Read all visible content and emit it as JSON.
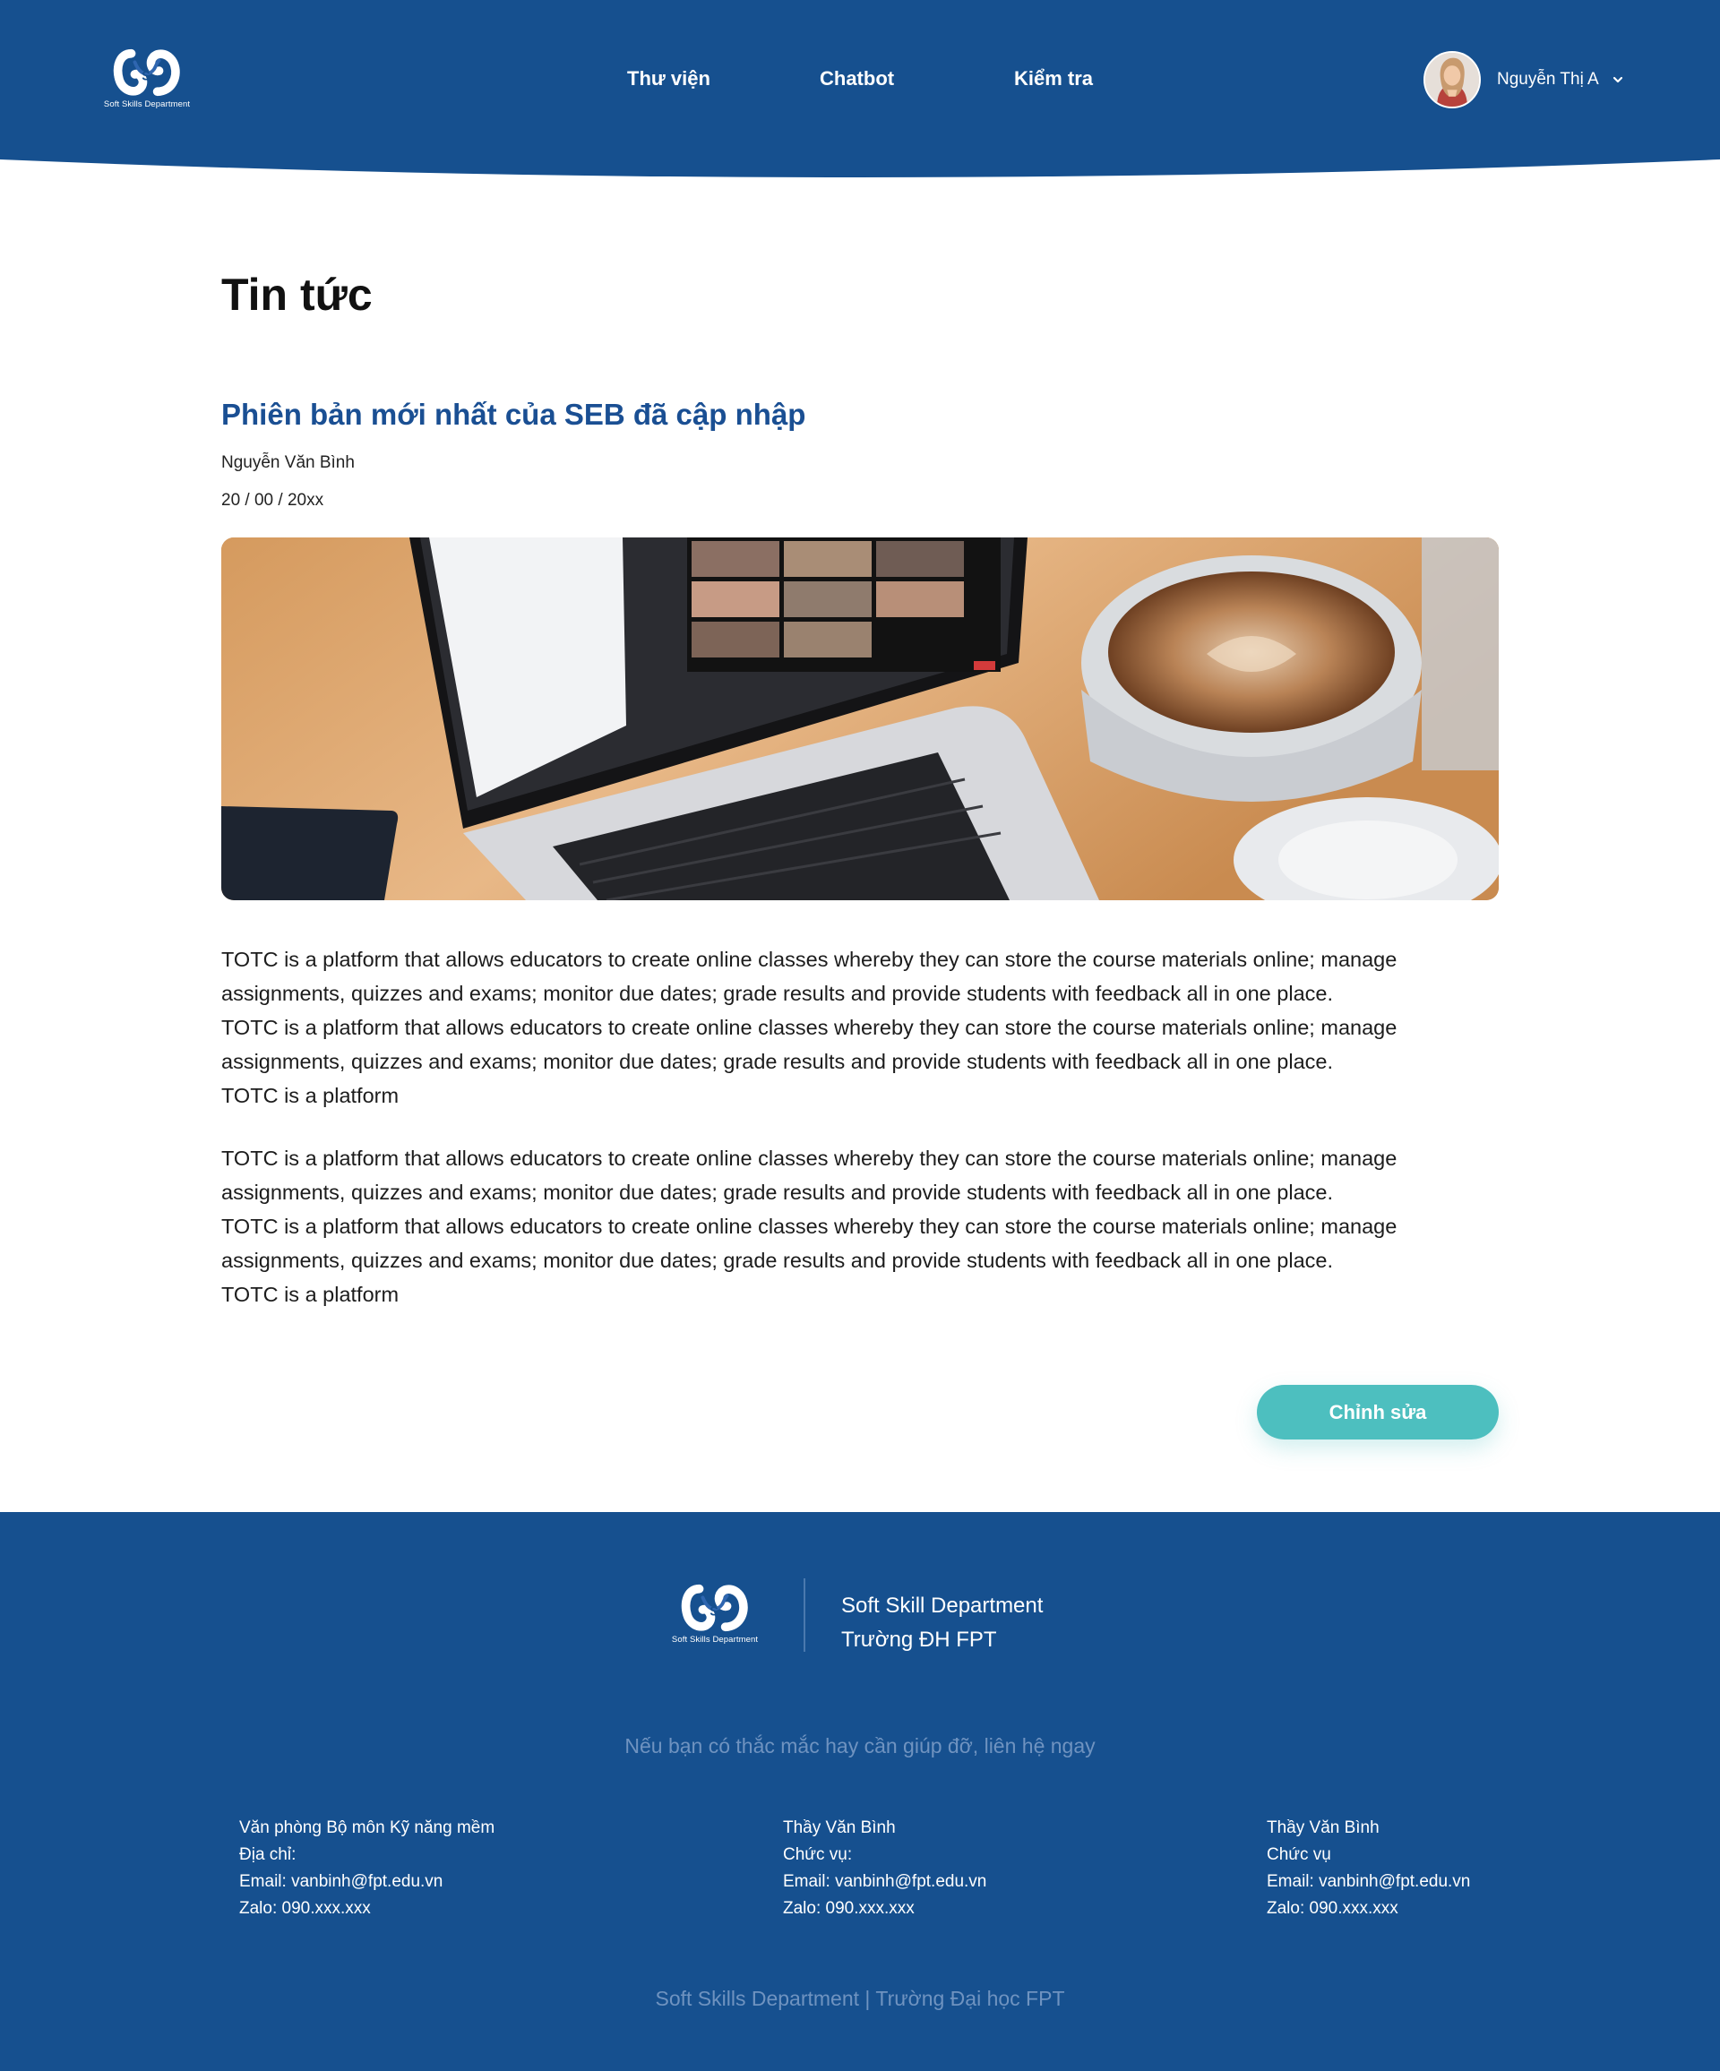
{
  "header": {
    "logo_caption": "Soft Skills Department",
    "nav": [
      {
        "label": "Thư viện"
      },
      {
        "label": "Chatbot"
      },
      {
        "label": "Kiểm tra"
      }
    ],
    "user_name": "Nguyễn Thị A"
  },
  "main": {
    "page_title": "Tin tức",
    "article": {
      "title": "Phiên bản mới nhất của SEB đã cập nhập",
      "author": "Nguyễn Văn Bình",
      "date": "20 / 00 / 20xx",
      "paragraphs": [
        "TOTC is a platform that allows educators to create online classes whereby they can store the course materials online; manage assignments, quizzes and exams; monitor due dates; grade results and provide students with feedback all in one place.\nTOTC is a platform that allows educators to create online classes whereby they can store the course materials online; manage assignments, quizzes and exams; monitor due dates; grade results and provide students with feedback all in one place.\nTOTC is a platform",
        "TOTC is a platform that allows educators to create online classes whereby they can store the course materials online; manage assignments, quizzes and exams; monitor due dates; grade results and provide students with feedback all in one place.\nTOTC is a platform that allows educators to create online classes whereby they can store the course materials online; manage assignments, quizzes and exams; monitor due dates; grade results and provide students with feedback all in one place.\nTOTC is a platform"
      ]
    },
    "edit_label": "Chỉnh sửa"
  },
  "footer": {
    "logo_caption": "Soft Skills Department",
    "org_line1": "Soft Skill Department",
    "org_line2": "Trường ĐH FPT",
    "contact_cta": "Nếu bạn có thắc mắc hay cần giúp đỡ, liên hệ ngay",
    "columns": [
      {
        "lines": [
          "Văn phòng Bộ môn Kỹ năng mềm",
          "Địa chỉ:",
          "Email: vanbinh@fpt.edu.vn",
          "Zalo: 090.xxx.xxx"
        ]
      },
      {
        "lines": [
          "Thầy Văn Bình",
          "Chức vụ:",
          "Email: vanbinh@fpt.edu.vn",
          "Zalo: 090.xxx.xxx"
        ]
      },
      {
        "lines": [
          "Thầy Văn Bình",
          "Chức vụ",
          "Email: vanbinh@fpt.edu.vn",
          "Zalo: 090.xxx.xxx"
        ]
      }
    ],
    "copyright": "Soft Skills Department | Trường Đại học FPT"
  },
  "colors": {
    "brand_blue": "#16508f",
    "title_blue": "#1a4f93",
    "accent_teal": "#4dbfbf"
  },
  "icons": [
    "soft-skills-logo-icon",
    "user-avatar",
    "chevron-down-icon"
  ]
}
